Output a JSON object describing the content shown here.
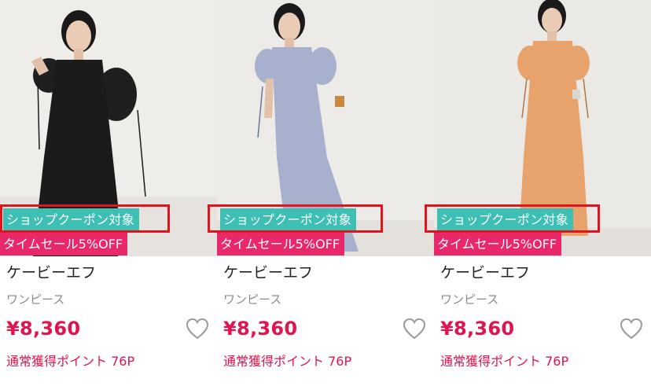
{
  "products": [
    {
      "coupon_label": "ショップクーポン対象",
      "sale_label": "タイムセール5%OFF",
      "brand": "ケービーエフ",
      "category": "ワンピース",
      "price": "¥8,360",
      "points": "通常獲得ポイント 76P",
      "dress_color": "#1b1b1b",
      "background_color": "#efedea"
    },
    {
      "coupon_label": "ショップクーポン対象",
      "sale_label": "タイムセール5%OFF",
      "brand": "ケービーエフ",
      "category": "ワンピース",
      "price": "¥8,360",
      "points": "通常獲得ポイント 76P",
      "dress_color": "#a7b0cc",
      "background_color": "#ecebe8"
    },
    {
      "coupon_label": "ショップクーポン対象",
      "sale_label": "タイムセール5%OFF",
      "brand": "ケービーエフ",
      "category": "ワンピース",
      "price": "¥8,360",
      "points": "通常獲得ポイント 76P",
      "dress_color": "#e8a36c",
      "background_color": "#ebe9e6"
    }
  ],
  "colors": {
    "coupon_badge": "#3dbfb4",
    "sale_badge": "#e8286b",
    "price": "#e0144e",
    "highlight_outline": "#e0141e"
  }
}
